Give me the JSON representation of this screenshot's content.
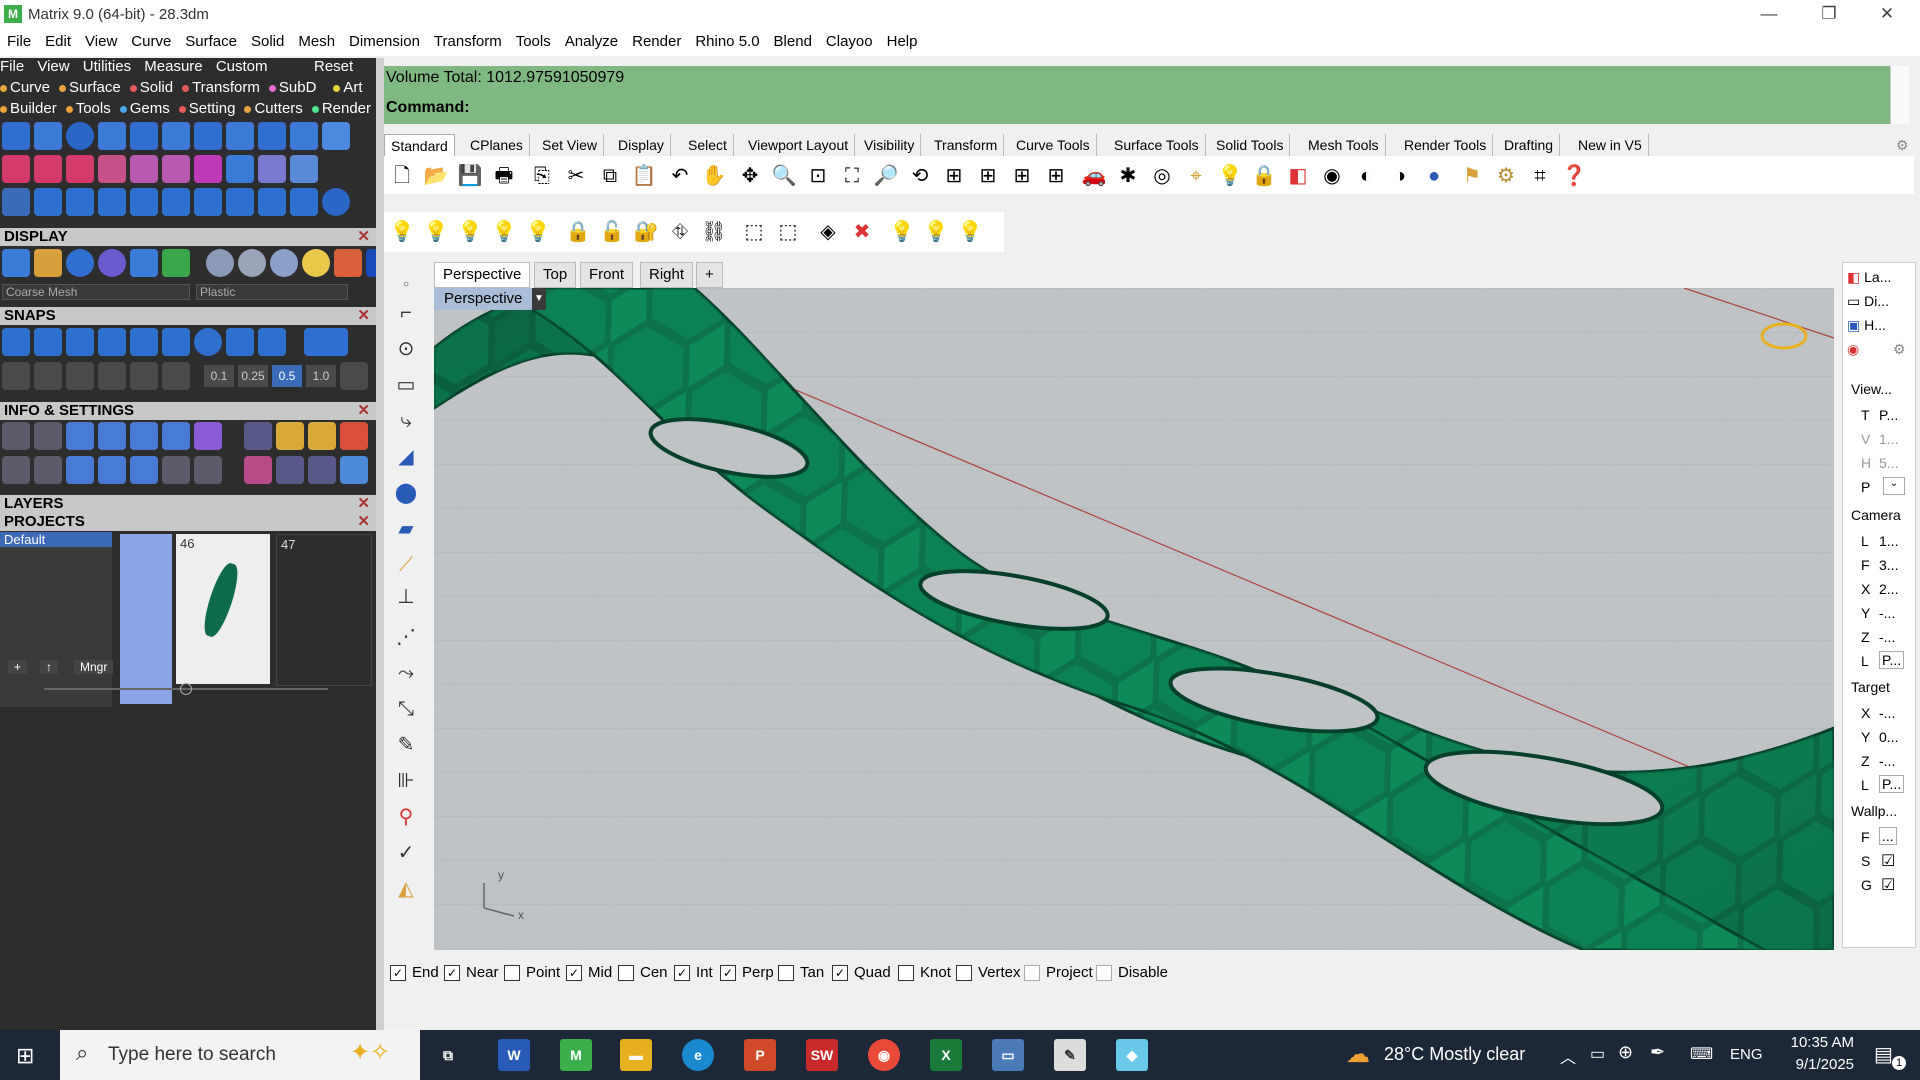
{
  "window": {
    "title": "Matrix 9.0 (64-bit) - 28.3dm",
    "minimize": "—",
    "restore": "❐",
    "close": "✕"
  },
  "menu": [
    "File",
    "Edit",
    "View",
    "Curve",
    "Surface",
    "Solid",
    "Mesh",
    "Dimension",
    "Transform",
    "Tools",
    "Analyze",
    "Render",
    "Rhino 5.0",
    "Blend",
    "Clayoo",
    "Help"
  ],
  "left_panel": {
    "menu": [
      "File",
      "View",
      "Utilities",
      "Measure",
      "Custom"
    ],
    "reset": "Reset",
    "row2": [
      "Curve",
      "Surface",
      "Solid",
      "Transform",
      "SubD",
      "Art"
    ],
    "row3": [
      "Builder",
      "Tools",
      "Gems",
      "Setting",
      "Cutters",
      "Render"
    ],
    "display_header": "DISPLAY",
    "mesh_select": "Coarse Mesh",
    "material_select": "Plastic",
    "snaps_header": "SNAPS",
    "snap_values": [
      "0.1",
      "0.25",
      "0.5",
      "1.0"
    ],
    "info_header": "INFO & SETTINGS",
    "layers_header": "LAYERS",
    "projects_header": "PROJECTS",
    "layer_default": "Default",
    "thumb_46": "46",
    "thumb_47": "47",
    "mngr": "Mngr"
  },
  "command": {
    "line1": "Volume Total: 1012.97591050979",
    "line2": "Command:"
  },
  "toolbar_tabs": [
    "Standard",
    "CPlanes",
    "Set View",
    "Display",
    "Select",
    "Viewport Layout",
    "Visibility",
    "Transform",
    "Curve Tools",
    "Surface Tools",
    "Solid Tools",
    "Mesh Tools",
    "Render Tools",
    "Drafting",
    "New in V5"
  ],
  "viewport_tabs": [
    "Perspective",
    "Top",
    "Front",
    "Right"
  ],
  "viewport_add": "+",
  "viewport_label": "Perspective",
  "viewport_arrow": "▼",
  "axis": {
    "x": "x",
    "y": "y"
  },
  "osnaps": [
    {
      "label": "End",
      "checked": true
    },
    {
      "label": "Near",
      "checked": true
    },
    {
      "label": "Point",
      "checked": false
    },
    {
      "label": "Mid",
      "checked": true
    },
    {
      "label": "Cen",
      "checked": false
    },
    {
      "label": "Int",
      "checked": true
    },
    {
      "label": "Perp",
      "checked": true
    },
    {
      "label": "Tan",
      "checked": false
    },
    {
      "label": "Quad",
      "checked": true
    },
    {
      "label": "Knot",
      "checked": false
    },
    {
      "label": "Vertex",
      "checked": false
    },
    {
      "label": "Project",
      "checked": false
    },
    {
      "label": "Disable",
      "checked": false
    }
  ],
  "right_panel": {
    "tabs": [
      "La...",
      "Di...",
      "H..."
    ],
    "view": "View...",
    "view_rows": [
      "T",
      "V",
      "H",
      "P"
    ],
    "view_vals": [
      "P...",
      "1...",
      "5...",
      ""
    ],
    "camera": "Camera",
    "camera_rows": [
      "L",
      "F",
      "X",
      "Y",
      "Z",
      "L"
    ],
    "camera_vals": [
      "1...",
      "3...",
      "2...",
      "-...",
      "-...",
      "P..."
    ],
    "target": "Target",
    "target_rows": [
      "X",
      "Y",
      "Z",
      "L"
    ],
    "target_vals": [
      "-...",
      "0...",
      "-...",
      "P..."
    ],
    "wallp": "Wallp...",
    "wallp_rows": [
      "F",
      "S",
      "G"
    ],
    "wallp_vals": [
      "...",
      "☑",
      "☑"
    ]
  },
  "taskbar": {
    "search_placeholder": "Type here to search",
    "weather": "28°C  Mostly clear",
    "lang": "ENG",
    "time": "10:35 AM",
    "date": "9/1/2025",
    "notif_count": "1"
  },
  "colors": {
    "command_bg": "#7fb881",
    "model": "#0d8a5a",
    "viewport_bg": "#bfc3c6"
  }
}
